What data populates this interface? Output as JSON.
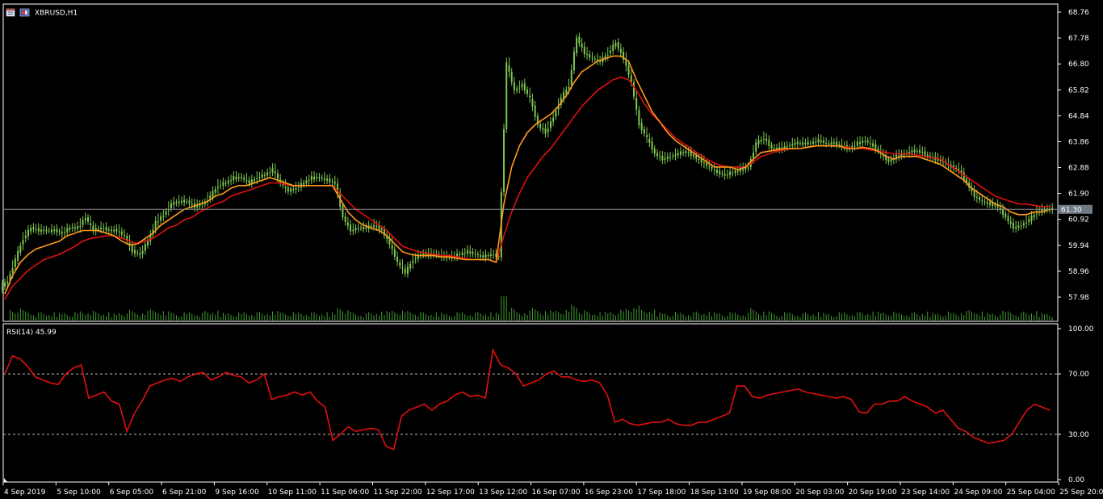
{
  "header": {
    "symbol_label": "XBRUSD,H1"
  },
  "rsi_header": "RSI(14) 45.99",
  "current_price_label": "61.30",
  "colors": {
    "background": "#000000",
    "frame": "#ffffff",
    "bull_candle": "#7ec850",
    "volume": "#3f9f2f",
    "ma_fast": "#ff9a1a",
    "ma_slow": "#e01010",
    "rsi_line": "#e01010",
    "current_price_line": "#8a8a8a",
    "price_tag_bg": "#707a86"
  },
  "chart_data": {
    "type": "candlestick",
    "symbol": "XBRUSD",
    "timeframe": "H1",
    "price_axis_ticks": [
      "68.76",
      "67.78",
      "66.80",
      "65.82",
      "64.84",
      "63.86",
      "62.88",
      "61.90",
      "60.92",
      "59.94",
      "58.96",
      "57.98"
    ],
    "ylim": [
      57.6,
      68.9
    ],
    "current_price": 61.3,
    "time_axis_labels": [
      "4 Sep 2019",
      "5 Sep 10:00",
      "6 Sep 05:00",
      "6 Sep 21:00",
      "9 Sep 16:00",
      "10 Sep 11:00",
      "11 Sep 06:00",
      "11 Sep 22:00",
      "12 Sep 17:00",
      "13 Sep 12:00",
      "16 Sep 07:00",
      "16 Sep 23:00",
      "17 Sep 18:00",
      "18 Sep 13:00",
      "19 Sep 08:00",
      "20 Sep 03:00",
      "20 Sep 19:00",
      "23 Sep 14:00",
      "24 Sep 09:00",
      "25 Sep 04:00",
      "25 Sep 20:00"
    ],
    "close_series": [
      58.6,
      59.4,
      60.2,
      60.6,
      60.5,
      60.5,
      60.5,
      60.4,
      60.6,
      60.6,
      61.0,
      60.5,
      60.6,
      60.5,
      60.5,
      60.3,
      59.7,
      59.6,
      60.1,
      60.8,
      61.1,
      61.5,
      61.6,
      61.6,
      61.4,
      61.5,
      61.8,
      62.2,
      62.3,
      62.5,
      62.5,
      62.3,
      62.5,
      62.6,
      62.8,
      62.3,
      62.0,
      62.1,
      62.3,
      62.5,
      62.5,
      62.4,
      62.3,
      61.0,
      60.5,
      60.6,
      60.6,
      60.7,
      60.5,
      60.0,
      59.3,
      58.9,
      59.4,
      59.6,
      59.6,
      59.6,
      59.5,
      59.5,
      59.6,
      59.7,
      59.6,
      59.5,
      59.6,
      59.5,
      66.8,
      65.8,
      66.0,
      65.5,
      64.5,
      64.2,
      64.8,
      65.5,
      66.0,
      67.8,
      67.2,
      67.0,
      66.9,
      67.2,
      67.6,
      67.0,
      66.1,
      64.5,
      64.0,
      63.4,
      63.2,
      63.3,
      63.4,
      63.5,
      63.3,
      63.1,
      62.9,
      62.7,
      62.6,
      62.7,
      62.8,
      62.9,
      63.8,
      64.0,
      63.6,
      63.6,
      63.7,
      63.8,
      63.8,
      63.8,
      63.9,
      63.8,
      63.8,
      63.7,
      63.6,
      63.8,
      63.9,
      63.7,
      63.4,
      63.1,
      63.3,
      63.4,
      63.5,
      63.5,
      63.3,
      63.2,
      63.1,
      62.9,
      62.8,
      62.3,
      61.8,
      61.6,
      61.5,
      61.4,
      61.0,
      60.6,
      60.7,
      60.9,
      61.2,
      61.3,
      61.3
    ],
    "ma_fast": [
      58.1,
      58.8,
      59.3,
      59.6,
      59.8,
      59.9,
      60.0,
      60.1,
      60.3,
      60.4,
      60.5,
      60.5,
      60.5,
      60.4,
      60.3,
      60.1,
      59.95,
      60.0,
      60.2,
      60.4,
      60.7,
      60.9,
      61.1,
      61.3,
      61.4,
      61.5,
      61.6,
      61.8,
      61.9,
      62.1,
      62.2,
      62.2,
      62.3,
      62.4,
      62.5,
      62.4,
      62.3,
      62.2,
      62.2,
      62.2,
      62.2,
      62.2,
      62.2,
      61.7,
      61.2,
      60.9,
      60.7,
      60.6,
      60.5,
      60.3,
      60.0,
      59.7,
      59.6,
      59.55,
      59.55,
      59.55,
      59.5,
      59.5,
      59.45,
      59.4,
      59.4,
      59.4,
      59.4,
      59.3,
      61.5,
      62.9,
      63.7,
      64.2,
      64.5,
      64.7,
      64.9,
      65.2,
      65.6,
      66.1,
      66.5,
      66.7,
      66.9,
      67.0,
      67.1,
      67.1,
      66.9,
      66.2,
      65.6,
      65.0,
      64.6,
      64.2,
      63.9,
      63.7,
      63.5,
      63.3,
      63.1,
      62.9,
      62.9,
      62.9,
      62.8,
      62.9,
      63.2,
      63.45,
      63.5,
      63.55,
      63.6,
      63.6,
      63.6,
      63.65,
      63.7,
      63.7,
      63.7,
      63.7,
      63.6,
      63.6,
      63.65,
      63.6,
      63.5,
      63.3,
      63.2,
      63.3,
      63.3,
      63.3,
      63.2,
      63.1,
      63.0,
      62.8,
      62.6,
      62.4,
      62.1,
      61.9,
      61.7,
      61.5,
      61.4,
      61.2,
      61.1,
      61.1,
      61.2,
      61.2,
      61.3
    ],
    "ma_slow": [
      57.9,
      58.4,
      58.7,
      59.0,
      59.2,
      59.4,
      59.5,
      59.6,
      59.75,
      59.9,
      60.1,
      60.2,
      60.25,
      60.3,
      60.3,
      60.2,
      60.1,
      60.0,
      60.1,
      60.2,
      60.4,
      60.6,
      60.7,
      60.9,
      61.0,
      61.2,
      61.35,
      61.5,
      61.6,
      61.8,
      61.9,
      62.0,
      62.1,
      62.2,
      62.3,
      62.3,
      62.25,
      62.2,
      62.2,
      62.2,
      62.2,
      62.2,
      62.2,
      61.9,
      61.6,
      61.3,
      61.1,
      60.9,
      60.7,
      60.5,
      60.2,
      59.9,
      59.8,
      59.7,
      59.65,
      59.6,
      59.55,
      59.55,
      59.5,
      59.45,
      59.4,
      59.4,
      59.4,
      59.3,
      60.3,
      61.2,
      61.9,
      62.5,
      62.9,
      63.3,
      63.6,
      64.0,
      64.4,
      64.8,
      65.2,
      65.5,
      65.8,
      66.0,
      66.2,
      66.3,
      66.2,
      65.8,
      65.3,
      64.9,
      64.6,
      64.3,
      64.0,
      63.8,
      63.6,
      63.4,
      63.2,
      63.05,
      62.95,
      62.9,
      62.9,
      62.9,
      63.1,
      63.3,
      63.4,
      63.5,
      63.55,
      63.6,
      63.6,
      63.65,
      63.7,
      63.7,
      63.7,
      63.7,
      63.65,
      63.6,
      63.6,
      63.55,
      63.5,
      63.45,
      63.4,
      63.4,
      63.4,
      63.35,
      63.3,
      63.25,
      63.2,
      63.0,
      62.8,
      62.6,
      62.4,
      62.2,
      62.0,
      61.8,
      61.7,
      61.6,
      61.5,
      61.5,
      61.45,
      61.4,
      61.4
    ],
    "rsi": {
      "period": 14,
      "last_value": 45.99,
      "levels": [
        70,
        30
      ],
      "axis_ticks": [
        "100.00",
        "70.00",
        "30.00",
        "0.00"
      ],
      "ylim": [
        0,
        100
      ],
      "values": [
        70,
        82,
        80,
        75,
        68,
        66,
        64,
        63,
        70,
        74,
        76,
        54,
        56,
        58,
        52,
        50,
        32,
        44,
        52,
        62,
        64,
        66,
        67,
        65,
        68,
        70,
        71,
        66,
        68,
        71,
        69,
        68,
        64,
        66,
        70,
        53,
        55,
        56,
        58,
        56,
        58,
        52,
        48,
        26,
        30,
        35,
        32,
        33,
        34,
        33,
        22,
        20,
        42,
        46,
        48,
        50,
        46,
        50,
        52,
        56,
        58,
        55,
        56,
        54,
        86,
        76,
        74,
        70,
        62,
        64,
        66,
        70,
        72,
        68,
        68,
        66,
        65,
        66,
        64,
        56,
        38,
        40,
        37,
        36,
        37,
        38,
        38,
        40,
        37,
        36,
        36,
        38,
        38,
        40,
        42,
        44,
        62,
        62,
        55,
        54,
        56,
        57,
        58,
        59,
        60,
        58,
        57,
        56,
        55,
        54,
        55,
        53,
        45,
        44,
        50,
        50,
        52,
        52,
        55,
        52,
        50,
        48,
        44,
        46,
        40,
        34,
        32,
        28,
        26,
        24,
        25,
        26,
        30,
        38,
        46,
        50,
        48,
        46
      ]
    }
  }
}
